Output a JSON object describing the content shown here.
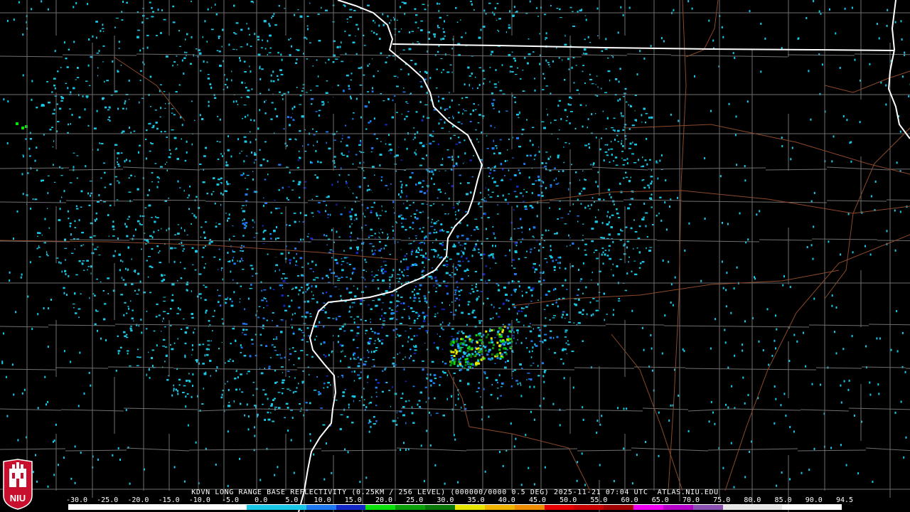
{
  "title": "KDVN LONG RANGE BASE REFLECTIVITY (0.25KM / 256 LEVEL) (000000/0000 0.5 DEG) 2025-11-21 07:04 UTC  ATLAS.NIU.EDU",
  "logo_text": "NIU",
  "scale": {
    "labels": [
      "-30.0",
      "-25.0",
      "-20.0",
      "-15.0",
      "-10.0",
      "-5.0",
      "0.0",
      "5.0",
      "10.0",
      "15.0",
      "20.0",
      "25.0",
      "30.0",
      "35.0",
      "40.0",
      "45.0",
      "50.0",
      "55.0",
      "60.0",
      "65.0",
      "70.0",
      "75.0",
      "80.0",
      "85.0",
      "90.0",
      "94.5"
    ],
    "colors": [
      "#ffffff",
      "#ffffff",
      "#ffffff",
      "#ffffff",
      "#ffffff",
      "#ffffff",
      "#19c8e6",
      "#19c8e6",
      "#1e78f0",
      "#1428c8",
      "#0ae10a",
      "#0aa00a",
      "#087808",
      "#e6e600",
      "#f0b400",
      "#f08c00",
      "#e60000",
      "#c80000",
      "#a00000",
      "#f000f0",
      "#b400c8",
      "#8c50b4",
      "#e6e6e6",
      "#e6e6e6",
      "#ffffff",
      "#ffffff"
    ]
  },
  "colors": {
    "background": "#000000",
    "county_lines": "#6e6e6e",
    "state_lines": "#ffffff",
    "highways": "#8b4a2a"
  }
}
